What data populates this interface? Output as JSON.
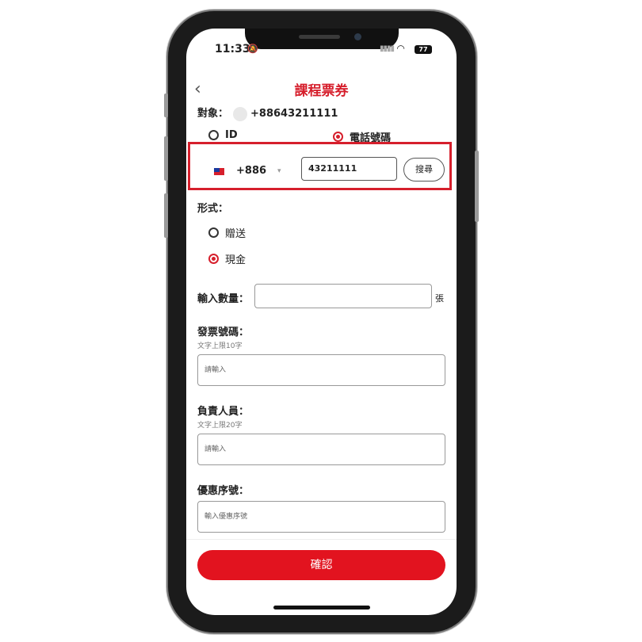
{
  "status_bar": {
    "time": "11:33",
    "battery": "77"
  },
  "header": {
    "title": "課程票券"
  },
  "target": {
    "label": "對象：",
    "phone": "+88643211111"
  },
  "search_mode": {
    "options": [
      {
        "label": "ID",
        "selected": false
      },
      {
        "label": "電話號碼",
        "selected": true
      }
    ]
  },
  "phone_search": {
    "country_code": "+886",
    "phone_value": "43211111",
    "search_label": "搜尋"
  },
  "form_type": {
    "label": "形式：",
    "options": [
      {
        "label": "贈送",
        "selected": false
      },
      {
        "label": "現金",
        "selected": true
      }
    ]
  },
  "quantity": {
    "label": "輸入數量：",
    "unit": "張",
    "value": ""
  },
  "invoice": {
    "label": "發票號碼：",
    "hint": "文字上限10字",
    "placeholder": "請輸入"
  },
  "staff": {
    "label": "負責人員：",
    "hint": "文字上限20字",
    "placeholder": "請輸入"
  },
  "coupon": {
    "label": "優惠序號：",
    "placeholder": "輸入優惠序號"
  },
  "confirm_label": "確認",
  "colors": {
    "accent": "#e2131f",
    "title": "#d61f2c"
  }
}
